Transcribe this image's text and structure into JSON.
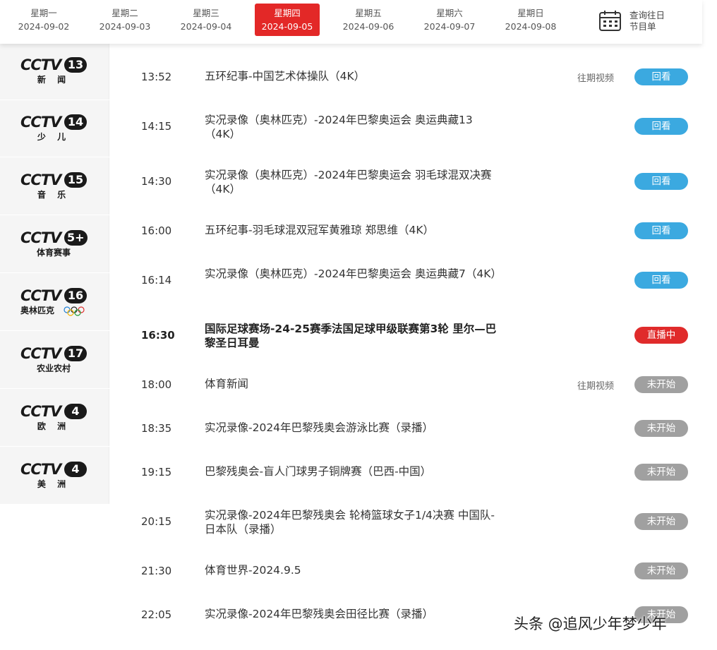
{
  "date_bar": {
    "days": [
      {
        "weekday": "星期一",
        "date": "2024-09-02"
      },
      {
        "weekday": "星期二",
        "date": "2024-09-03"
      },
      {
        "weekday": "星期三",
        "date": "2024-09-04"
      },
      {
        "weekday": "星期四",
        "date": "2024-09-05"
      },
      {
        "weekday": "星期五",
        "date": "2024-09-06"
      },
      {
        "weekday": "星期六",
        "date": "2024-09-07"
      },
      {
        "weekday": "星期日",
        "date": "2024-09-08"
      }
    ],
    "active_date": "2024-09-05",
    "history_label": "查询往日\n节目单",
    "accent_color": "#e32827"
  },
  "channels": [
    {
      "brand": "CCTV",
      "number": "13",
      "subtitle": "新 闻"
    },
    {
      "brand": "CCTV",
      "number": "14",
      "subtitle": "少 儿"
    },
    {
      "brand": "CCTV",
      "number": "15",
      "subtitle": "音 乐"
    },
    {
      "brand": "CCTV",
      "number": "5+",
      "subtitle": "体育赛事"
    },
    {
      "brand": "CCTV",
      "number": "16",
      "subtitle": "奥林匹克"
    },
    {
      "brand": "CCTV",
      "number": "17",
      "subtitle": "农业农村"
    },
    {
      "brand": "CCTV",
      "number": "4",
      "subtitle": "欧 洲"
    },
    {
      "brand": "CCTV",
      "number": "4",
      "subtitle": "美 洲"
    }
  ],
  "programs": [
    {
      "time": "13:52",
      "title": "五环纪事-中国艺术体操队（4K）",
      "past_label": "往期视频",
      "status": "回看",
      "state": "replay"
    },
    {
      "time": "14:15",
      "title": "实况录像（奥林匹克）-2024年巴黎奥运会 奥运典藏13（4K）",
      "past_label": "",
      "status": "回看",
      "state": "replay"
    },
    {
      "time": "14:30",
      "title": "实况录像（奥林匹克）-2024年巴黎奥运会 羽毛球混双决赛（4K）",
      "past_label": "",
      "status": "回看",
      "state": "replay"
    },
    {
      "time": "16:00",
      "title": "五环纪事-羽毛球混双冠军黄雅琼 郑思维（4K）",
      "past_label": "",
      "status": "回看",
      "state": "replay"
    },
    {
      "time": "16:14",
      "title": "实况录像（奥林匹克）-2024年巴黎奥运会 奥运典藏7（4K）",
      "past_label": "",
      "status": "回看",
      "state": "replay"
    },
    {
      "time": "16:30",
      "title": "国际足球赛场-24-25赛季法国足球甲级联赛第3轮 里尔—巴黎圣日耳曼",
      "past_label": "",
      "status": "直播中",
      "state": "live"
    },
    {
      "time": "18:00",
      "title": "体育新闻",
      "past_label": "往期视频",
      "status": "未开始",
      "state": "upcoming"
    },
    {
      "time": "18:35",
      "title": "实况录像-2024年巴黎残奥会游泳比赛（录播）",
      "past_label": "",
      "status": "未开始",
      "state": "upcoming"
    },
    {
      "time": "19:15",
      "title": "巴黎残奥会-盲人门球男子铜牌赛（巴西-中国）",
      "past_label": "",
      "status": "未开始",
      "state": "upcoming"
    },
    {
      "time": "20:15",
      "title": "实况录像-2024年巴黎残奥会 轮椅篮球女子1/4决赛 中国队-日本队（录播）",
      "past_label": "",
      "status": "未开始",
      "state": "upcoming"
    },
    {
      "time": "21:30",
      "title": "体育世界-2024.9.5",
      "past_label": "",
      "status": "未开始",
      "state": "upcoming"
    },
    {
      "time": "22:05",
      "title": "实况录像-2024年巴黎残奥会田径比赛（录播）",
      "past_label": "",
      "status": "未开始",
      "state": "upcoming"
    }
  ],
  "colors": {
    "replay": "#3ba9e0",
    "live": "#e02b2b",
    "upcoming": "#a0a0a0"
  },
  "watermark": "头条 @追风少年梦少年"
}
